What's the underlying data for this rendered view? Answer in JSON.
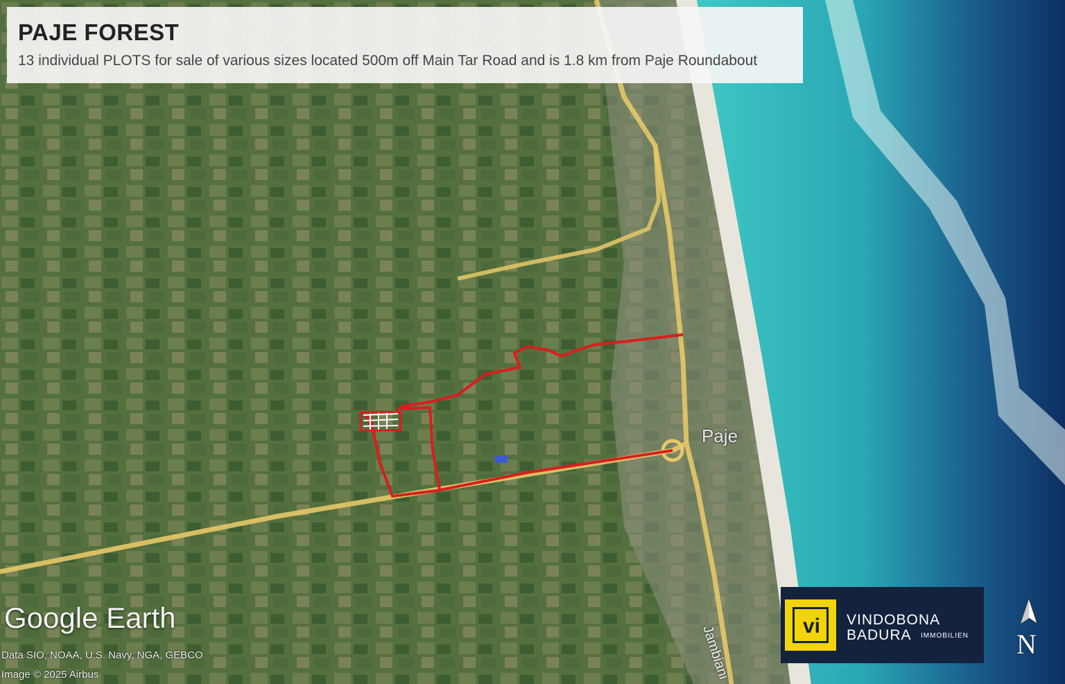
{
  "title": "PAJE FOREST",
  "subtitle": "13 individual PLOTS for sale of various sizes located 500m off Main Tar Road and is 1.8 km from Paje Roundabout",
  "place_label": "Paje",
  "road_label": "Jambiani",
  "google_earth_logo": "Google Earth",
  "attribution": {
    "line1": "Data SIO, NOAA, U.S. Navy, NGA, GEBCO",
    "line2": "Image © 2025 Airbus"
  },
  "brand": {
    "mark": "vi",
    "name_line1": "VINDOBONA",
    "name_line2": "BADURA",
    "name_suffix": "IMMOBILIEN",
    "bg_color": "#13223d",
    "accent_color": "#f2d40a"
  },
  "north_indicator": "N",
  "colors": {
    "route": "#d81e1e",
    "plots": "#ffffff",
    "roads": "#e6c868"
  }
}
